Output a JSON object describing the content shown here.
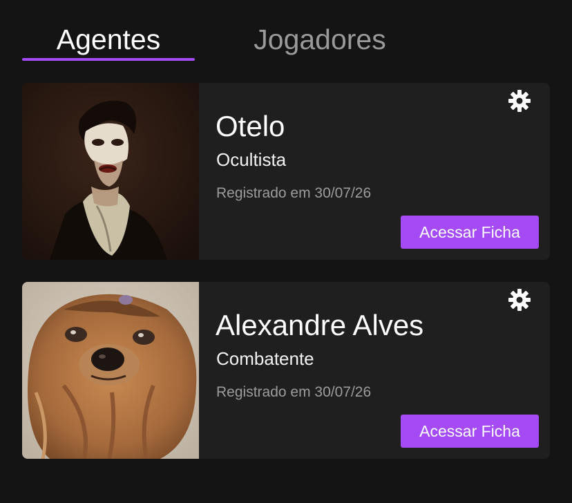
{
  "theme": {
    "accent": "#a44bf5",
    "background": "#141414",
    "card": "#1f1f1f"
  },
  "tabs": [
    {
      "label": "Agentes",
      "active": true
    },
    {
      "label": "Jogadores",
      "active": false
    }
  ],
  "agents": [
    {
      "name": "Otelo",
      "class": "Ocultista",
      "registered": "Registrado em 30/07/26",
      "button_label": "Acessar Ficha",
      "settings_icon": "gear-icon",
      "portrait": "masked-man-painting"
    },
    {
      "name": "Alexandre Alves",
      "class": "Combatente",
      "registered": "Registrado em 30/07/26",
      "button_label": "Acessar Ficha",
      "settings_icon": "gear-icon",
      "portrait": "yorkshire-dog-photo"
    }
  ]
}
